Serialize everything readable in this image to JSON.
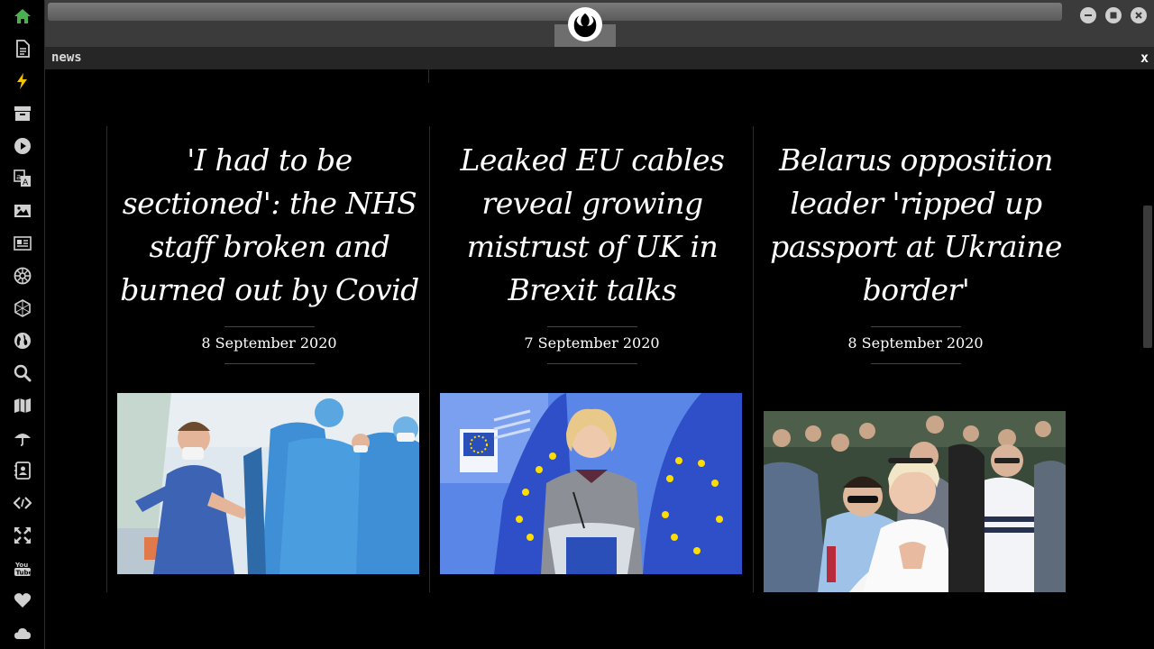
{
  "window": {
    "panel_title": "news",
    "close_label": "x"
  },
  "sidebar": {
    "items": [
      {
        "icon": "home-icon",
        "color": "#4caf50"
      },
      {
        "icon": "document-icon",
        "color": "#d0d0d0"
      },
      {
        "icon": "lightning-icon",
        "color": "#f2c200"
      },
      {
        "icon": "archive-icon",
        "color": "#d0d0d0"
      },
      {
        "icon": "play-icon",
        "color": "#d0d0d0"
      },
      {
        "icon": "translate-icon",
        "color": "#d0d0d0"
      },
      {
        "icon": "image-icon",
        "color": "#d0d0d0"
      },
      {
        "icon": "newspaper-icon",
        "color": "#d0d0d0"
      },
      {
        "icon": "empire-icon",
        "color": "#d0d0d0"
      },
      {
        "icon": "hexagon-network-icon",
        "color": "#d0d0d0"
      },
      {
        "icon": "globe-icon",
        "color": "#d0d0d0"
      },
      {
        "icon": "search-icon",
        "color": "#d0d0d0"
      },
      {
        "icon": "map-icon",
        "color": "#d0d0d0"
      },
      {
        "icon": "umbrella-icon",
        "color": "#d0d0d0"
      },
      {
        "icon": "contact-book-icon",
        "color": "#d0d0d0"
      },
      {
        "icon": "code-icon",
        "color": "#d0d0d0"
      },
      {
        "icon": "expand-arrows-icon",
        "color": "#d0d0d0"
      },
      {
        "icon": "youtube-icon",
        "color": "#d0d0d0"
      },
      {
        "icon": "heart-icon",
        "color": "#d0d0d0"
      },
      {
        "icon": "cloud-icon",
        "color": "#d0d0d0"
      }
    ]
  },
  "articles": [
    {
      "headline": "'I had to be sectioned': the NHS staff broken and burned out by Covid",
      "date": "8 September 2020",
      "image": "nhs-staff-in-ppe-photo"
    },
    {
      "headline": "Leaked EU cables reveal growing mistrust of UK in Brexit talks",
      "date": "7 September 2020",
      "image": "eu-commission-president-podium-photo"
    },
    {
      "headline": "Belarus opposition leader 'ripped up passport at Ukraine border'",
      "date": "8 September 2020",
      "image": "belarus-opposition-crowd-photo"
    }
  ],
  "colors": {
    "accent_home": "#4caf50",
    "accent_lightning": "#f2c200",
    "eu_blue": "#3f63d6",
    "eu_star": "#ffdd00",
    "ppe_blue": "#3f8fd6"
  }
}
